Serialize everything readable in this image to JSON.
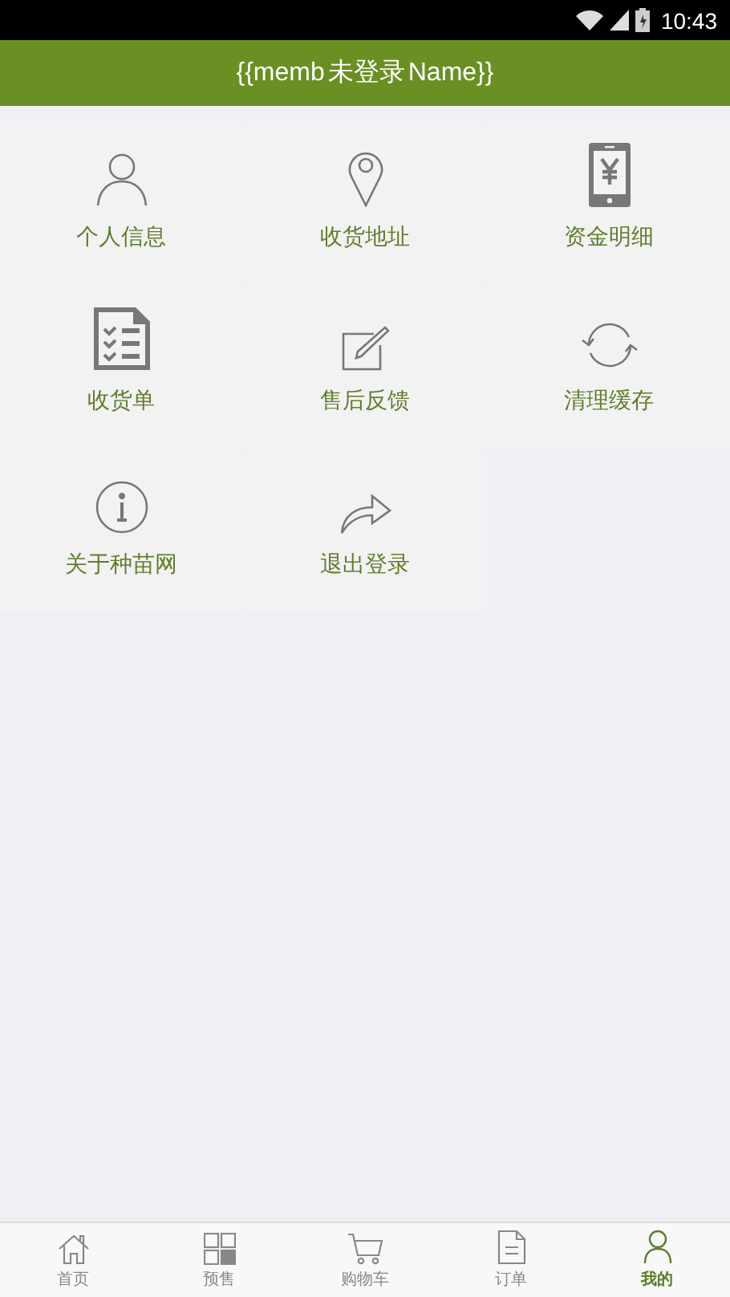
{
  "status_bar": {
    "time": "10:43"
  },
  "header": {
    "title_start": "{{memb",
    "overlay_title": "未登录",
    "title_end": "Name}}"
  },
  "menu": [
    {
      "kind": "person",
      "label": "个人信息"
    },
    {
      "kind": "pin",
      "label": "收货地址"
    },
    {
      "kind": "phone-yen",
      "label": "资金明细"
    },
    {
      "kind": "checklist",
      "label": "收货单"
    },
    {
      "kind": "edit",
      "label": "售后反馈"
    },
    {
      "kind": "refresh",
      "label": "清理缓存"
    },
    {
      "kind": "info",
      "label": "关于种苗网"
    },
    {
      "kind": "share",
      "label": "退出登录"
    }
  ],
  "tab_bar": [
    {
      "kind": "home",
      "label": "首页",
      "selected": false
    },
    {
      "kind": "grid",
      "label": "预售",
      "selected": false
    },
    {
      "kind": "cart",
      "label": "购物车",
      "selected": false
    },
    {
      "kind": "doc",
      "label": "订单",
      "selected": false
    },
    {
      "kind": "person",
      "label": "我的",
      "selected": true
    }
  ]
}
